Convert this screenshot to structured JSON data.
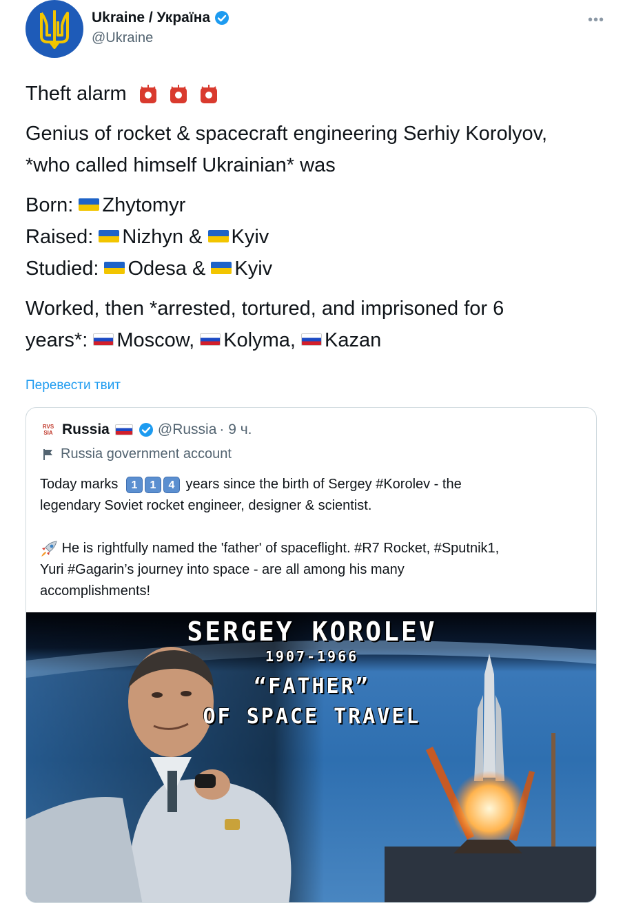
{
  "header": {
    "display_name": "Ukraine / Україна",
    "handle": "@Ukraine",
    "more_label": "•••"
  },
  "tweet": {
    "line1": "Theft alarm",
    "line2a": "Genius of rocket & spacecraft engineering Serhiy Korolyov,",
    "line2b": "*who called himself Ukrainian* was",
    "born_label": "Born:",
    "born_city": "Zhytomyr",
    "raised_label": "Raised:",
    "raised_city1": "Nizhyn &",
    "raised_city2": "Kyiv",
    "studied_label": "Studied:",
    "studied_city1": "Odesa &",
    "studied_city2": "Kyiv",
    "worked_a": "Worked, then *arrested, tortured, and imprisoned for 6",
    "worked_b": "years*:",
    "worked_city1": "Moscow,",
    "worked_city2": "Kolyma,",
    "worked_city3": "Kazan"
  },
  "translate_label": "Перевести твит",
  "quote": {
    "name": "Russia",
    "handle": "@Russia",
    "time": "· 9 ч.",
    "label": "Russia government account",
    "p1_a": "Today marks",
    "digits": [
      "1",
      "1",
      "4"
    ],
    "p1_b": "years since the birth of Sergey #Korolev - the",
    "p1_c": "legendary Soviet rocket engineer, designer & scientist.",
    "p2_a": "He is rightfully named the 'father' of spaceflight. #R7 Rocket, #Sputnik1,",
    "p2_b": "Yuri #Gagarin’s journey into space - are all among his many",
    "p2_c": "accomplishments!",
    "image": {
      "title": "SERGEY KOROLEV",
      "years": "1907-1966",
      "subtitle1": "“FATHER”",
      "subtitle2": "OF SPACE TRAVEL"
    }
  },
  "colors": {
    "link": "#1d9bf0",
    "verified": "#1d9bf0",
    "ua_blue": "#1e63c7",
    "ua_yellow": "#f2c500"
  },
  "icons": [
    "trident-icon",
    "verified-badge-icon",
    "siren-icon",
    "flag-ua-icon",
    "flag-ru-icon",
    "government-flag-icon",
    "rocket-icon"
  ]
}
